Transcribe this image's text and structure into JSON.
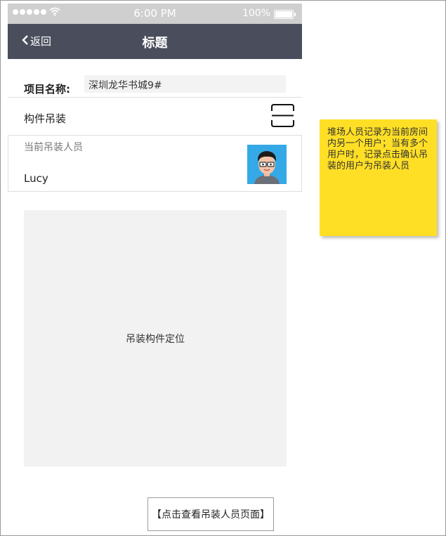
{
  "status_bar": {
    "time": "6:00 PM",
    "battery": "100%",
    "signal_icon": "signal-dots-icon",
    "wifi_icon": "wifi-icon",
    "battery_icon": "battery-icon"
  },
  "nav": {
    "back_label": "返回",
    "title": "标题",
    "background": "#4a4e5c"
  },
  "form": {
    "project_label": "项目名称:",
    "project_value": "深圳龙华书城9#",
    "component_label": "构件吊装",
    "scan_icon": "scan-icon",
    "staff_caption": "当前吊装人员",
    "staff_name": "Lucy",
    "avatar_icon": "avatar-icon"
  },
  "map": {
    "label": "吊装构件定位"
  },
  "footer": {
    "view_staff_link": "【点击查看吊装人员页面】"
  },
  "note": {
    "text": "堆场人员记录为当前房间内另一个用户；当有多个用户时，记录点击确认吊装的用户为吊装人员",
    "color": "#ffdf25"
  }
}
